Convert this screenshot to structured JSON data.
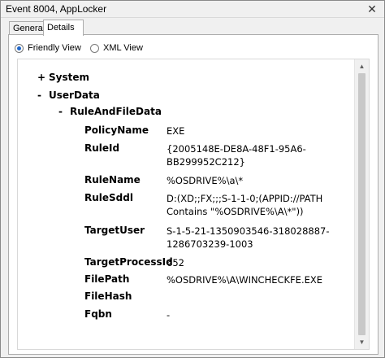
{
  "window": {
    "title": "Event 8004, AppLocker",
    "close_glyph": "✕"
  },
  "tabs": [
    {
      "label": "General"
    },
    {
      "label": "Details"
    }
  ],
  "view_options": [
    {
      "label": "Friendly View",
      "selected": true
    },
    {
      "label": "XML View",
      "selected": false
    }
  ],
  "tree": {
    "system": {
      "toggle": "+",
      "label": "System"
    },
    "userdata": {
      "toggle": "-",
      "label": "UserData"
    },
    "ruleandfiledata": {
      "toggle": "-",
      "label": "RuleAndFileData"
    }
  },
  "fields": [
    {
      "name": "PolicyName",
      "value": [
        "EXE"
      ]
    },
    {
      "name": "RuleId",
      "value": [
        "{2005148E-DE8A-48F1-95A6-",
        "BB299952C212}"
      ]
    },
    {
      "name": "RuleName",
      "value": [
        "%OSDRIVE%\\a\\*"
      ]
    },
    {
      "name": "RuleSddl",
      "value": [
        "D:(XD;;FX;;;S-1-1-0;(APPID://PATH",
        "Contains \"%OSDRIVE%\\A\\*\"))"
      ]
    },
    {
      "name": "TargetUser",
      "value": [
        "S-1-5-21-1350903546-318028887-",
        "1286703239-1003"
      ]
    },
    {
      "name": "TargetProcessId",
      "value": [
        "652"
      ]
    },
    {
      "name": "FilePath",
      "value": [
        "%OSDRIVE%\\A\\WINCHECKFE.EXE"
      ]
    },
    {
      "name": "FileHash",
      "value": [
        ""
      ]
    },
    {
      "name": "Fqbn",
      "value": [
        "-"
      ]
    }
  ],
  "icons": {
    "close": "close-icon",
    "scroll_up": "arrow-up-icon",
    "scroll_down": "arrow-down-icon"
  }
}
